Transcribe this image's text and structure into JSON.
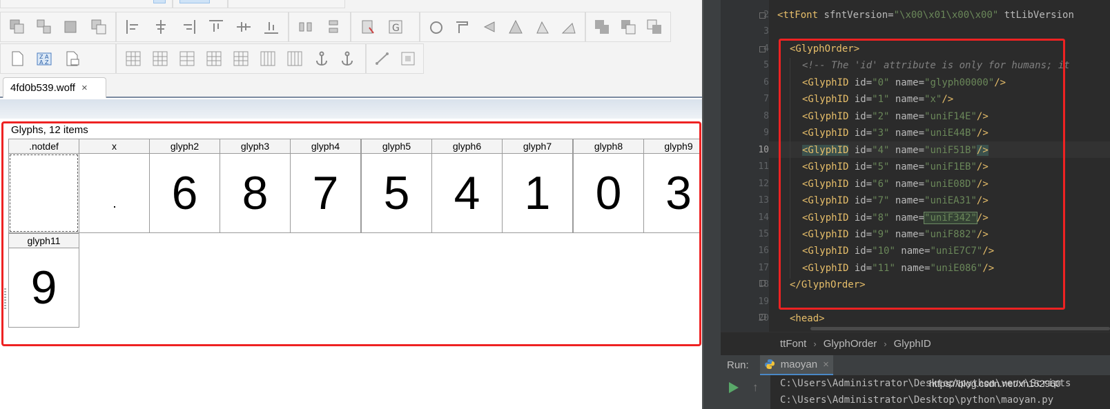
{
  "editor": {
    "tab_label": "4fd0b539.woff",
    "tab_close": "×",
    "panel_title": "Glyphs, 12 items",
    "glyphs": [
      {
        "name": ".notdef",
        "char": ""
      },
      {
        "name": "x",
        "char": ""
      },
      {
        "name": "glyph2",
        "char": "6"
      },
      {
        "name": "glyph3",
        "char": "8"
      },
      {
        "name": "glyph4",
        "char": "7"
      },
      {
        "name": "glyph5",
        "char": "5"
      },
      {
        "name": "glyph6",
        "char": "4"
      },
      {
        "name": "glyph7",
        "char": "1"
      },
      {
        "name": "glyph8",
        "char": "0"
      },
      {
        "name": "glyph9",
        "char": "3"
      },
      {
        "name": "glyph11",
        "char": "9"
      }
    ]
  },
  "ide": {
    "line_numbers": [
      "2",
      "3",
      "4",
      "5",
      "6",
      "7",
      "8",
      "9",
      "10",
      "11",
      "12",
      "13",
      "14",
      "15",
      "16",
      "17",
      "18",
      "19",
      "20"
    ],
    "current_line": "10",
    "code": {
      "l2_tag_open": "<ttFont",
      "l2_attr": " sfntVersion=",
      "l2_val": "\"\\x00\\x01\\x00\\x00\"",
      "l2_attr2": " ttLibVersion",
      "l4": "<GlyphOrder>",
      "l5": "<!-- The 'id' attribute is only for humans; it",
      "glyph_ids": [
        {
          "id": "\"0\"",
          "name": "\"glyph00000\""
        },
        {
          "id": "\"1\"",
          "name": "\"x\""
        },
        {
          "id": "\"2\"",
          "name": "\"uniF14E\""
        },
        {
          "id": "\"3\"",
          "name": "\"uniE44B\""
        },
        {
          "id": "\"4\"",
          "name": "\"uniF51B\""
        },
        {
          "id": "\"5\"",
          "name": "\"uniF1EB\""
        },
        {
          "id": "\"6\"",
          "name": "\"uniE08D\""
        },
        {
          "id": "\"7\"",
          "name": "\"uniEA31\""
        },
        {
          "id": "\"8\"",
          "name": "\"uniF342\""
        },
        {
          "id": "\"9\"",
          "name": "\"uniF882\""
        },
        {
          "id": "\"10\"",
          "name": "\"uniE7C7\""
        },
        {
          "id": "\"11\"",
          "name": "\"uniE086\""
        }
      ],
      "glyph_tag": "<GlyphID",
      "id_attr": " id=",
      "name_attr": " name=",
      "close": "/>",
      "l18": "</GlyphOrder>",
      "l20": "<head>"
    },
    "breadcrumb": [
      "ttFont",
      "GlyphOrder",
      "GlyphID"
    ],
    "run_label": "Run:",
    "run_tab": "maoyan",
    "run_close": "×",
    "console_lines": [
      "C:\\Users\\Administrator\\Desktop\\python\\venv\\Scripts",
      "C:\\Users\\Administrator\\Desktop\\python\\maoyan.py"
    ],
    "watermark": "https://blog.csdn.net/xh152960"
  },
  "colors": {
    "highlight_box": "#ee2222",
    "ide_bg": "#2b2b2b",
    "xml_tag": "#e8bf6a",
    "xml_value": "#6a8759"
  }
}
